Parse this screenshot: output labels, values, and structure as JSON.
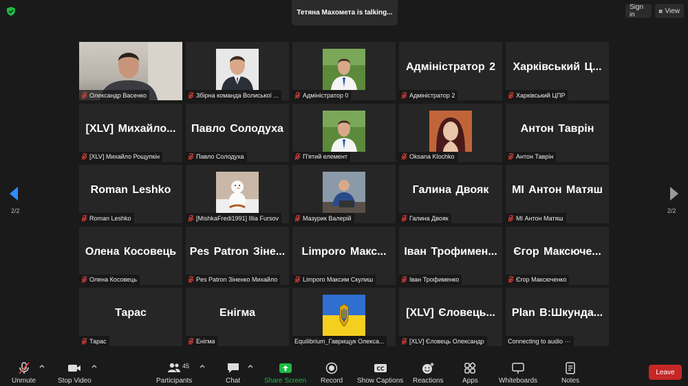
{
  "top": {
    "talking_text": "Тетяна Махомета is talking...",
    "sign_in": "Sign in",
    "view": "View"
  },
  "colors": {
    "accent_green": "#1fb944",
    "leave_red": "#c72727",
    "mute_red": "#e0413a"
  },
  "tiles": [
    {
      "big": "",
      "label": "Олександр Васенко",
      "kind": "video"
    },
    {
      "big": "",
      "label": "Збірна команда Волиської ...",
      "kind": "photo-man-suit"
    },
    {
      "big": "",
      "label": "Адміністратор 0",
      "kind": "photo-man-outdoor"
    },
    {
      "big": "Адміністратор 2",
      "label": "Адміністратор 2",
      "kind": "name"
    },
    {
      "big": "Харківський Ц...",
      "label": "Харківський ЦПР",
      "kind": "name"
    },
    {
      "big": "[XLV] Михайло...",
      "label": "[XLV] Михайло Рощупкін",
      "kind": "name"
    },
    {
      "big": "Павло Солодуха",
      "label": "Павло Солодуха",
      "kind": "name"
    },
    {
      "big": "",
      "label": "П'ятий елемент",
      "kind": "photo-man-outdoor"
    },
    {
      "big": "",
      "label": "Oksana Klochko",
      "kind": "photo-woman"
    },
    {
      "big": "Антон Таврін",
      "label": "Антон Таврін",
      "kind": "name"
    },
    {
      "big": "Roman Leshko",
      "label": "Roman Leshko",
      "kind": "name"
    },
    {
      "big": "",
      "label": "[MishkaFredi1991] Illia Fursov",
      "kind": "photo-snowman"
    },
    {
      "big": "",
      "label": "Мазурик Валерій",
      "kind": "photo-man-laptop"
    },
    {
      "big": "Галина Двояк",
      "label": "Галина Двояк",
      "kind": "name"
    },
    {
      "big": "MI Антон Матяш",
      "label": "MI Антон Матяш",
      "kind": "name"
    },
    {
      "big": "Олена Косовець",
      "label": "Олена Косовець",
      "kind": "name"
    },
    {
      "big": "Pes Patron Зіне...",
      "label": "Pes Patron Зіненко Михайло",
      "kind": "name"
    },
    {
      "big": "Limporo Макс...",
      "label": "Limporo Максим Скулиш",
      "kind": "name"
    },
    {
      "big": "Іван Трофимен...",
      "label": "Іван Трофименко",
      "kind": "name"
    },
    {
      "big": "Єгор Максюче...",
      "label": "Єгор Максюченко",
      "kind": "name"
    },
    {
      "big": "Тарас",
      "label": "Тарас",
      "kind": "name"
    },
    {
      "big": "Енігма",
      "label": "Енігма",
      "kind": "name"
    },
    {
      "big": "",
      "label": "Equilibrium_Гаврищук Олекса...",
      "kind": "photo-flag",
      "nomic": true
    },
    {
      "big": "[XLV] Єловець...",
      "label": "[XLV] Єловець Олександр",
      "kind": "name"
    },
    {
      "big": "Plan B:Шкунда...",
      "label": "Connecting to audio ···",
      "kind": "name",
      "nomic": true
    }
  ],
  "pages": {
    "left": "2/2",
    "right": "2/2"
  },
  "toolbar": {
    "unmute": "Unmute",
    "stop_video": "Stop Video",
    "participants": "Participants",
    "participants_count": "45",
    "chat": "Chat",
    "share_screen": "Share Screen",
    "record": "Record",
    "show_captions": "Show Captions",
    "reactions": "Reactions",
    "apps": "Apps",
    "whiteboards": "Whiteboards",
    "notes": "Notes",
    "leave": "Leave"
  }
}
